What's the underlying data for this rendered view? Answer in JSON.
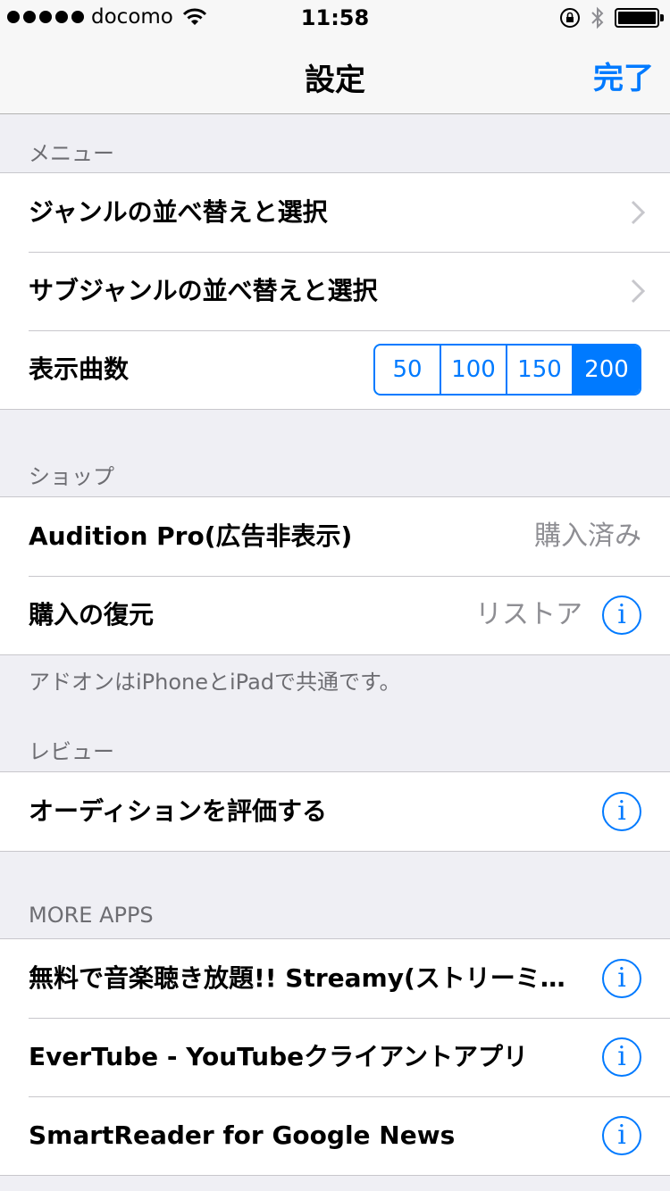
{
  "status": {
    "carrier": "docomo",
    "time": "11:58"
  },
  "nav": {
    "title": "設定",
    "done": "完了"
  },
  "sections": {
    "menu": {
      "header": "メニュー",
      "rows": [
        "ジャンルの並べ替えと選択",
        "サブジャンルの並べ替えと選択"
      ],
      "display_count_label": "表示曲数",
      "segments": [
        "50",
        "100",
        "150",
        "200"
      ],
      "selected_segment": "200"
    },
    "shop": {
      "header": "ショップ",
      "pro_label": "Audition Pro(広告非表示)",
      "pro_value": "購入済み",
      "restore_label": "購入の復元",
      "restore_value": "リストア",
      "footer": "アドオンはiPhoneとiPadで共通です。"
    },
    "review": {
      "header": "レビュー",
      "rate_label": "オーディションを評価する"
    },
    "more_apps": {
      "header": "MORE APPS",
      "apps": [
        "無料で音楽聴き放題!! Streamy(ストリーミー) - YouTube",
        "EverTube - YouTubeクライアントアプリ",
        "SmartReader for Google News"
      ]
    }
  },
  "info_glyph": "i",
  "colors": {
    "accent": "#007aff",
    "background": "#efeff4",
    "secondary_text": "#8e8e93"
  }
}
